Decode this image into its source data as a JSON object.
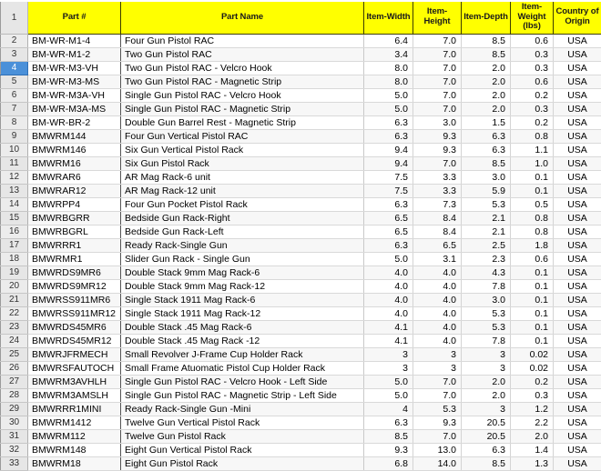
{
  "spreadsheet": {
    "header_row_number": "1",
    "selected_row_number": "4",
    "columns": [
      {
        "key": "rownum",
        "label": ""
      },
      {
        "key": "partnum",
        "label": "Part #"
      },
      {
        "key": "partname",
        "label": "Part Name"
      },
      {
        "key": "width",
        "label": "Item-Width"
      },
      {
        "key": "height",
        "label": "Item-Height"
      },
      {
        "key": "depth",
        "label": "Item-Depth"
      },
      {
        "key": "weight",
        "label": "Item-Weight (lbs)"
      },
      {
        "key": "country",
        "label": "Country of Origin"
      }
    ],
    "colors": {
      "header_background": "#ffff00",
      "header_text": "#1a1a1a",
      "row_header_background": "#ececec",
      "selection": "#4a90d9",
      "grid_line": "#d4d4d4"
    },
    "rows": [
      {
        "n": "2",
        "partnum": "BM-WR-M1-4",
        "partname": "Four Gun Pistol RAC",
        "width": "6.4",
        "height": "7.0",
        "depth": "8.5",
        "weight": "0.6",
        "country": "USA"
      },
      {
        "n": "3",
        "partnum": "BM-WR-M1-2",
        "partname": "Two Gun Pistol RAC",
        "width": "3.4",
        "height": "7.0",
        "depth": "8.5",
        "weight": "0.3",
        "country": "USA"
      },
      {
        "n": "4",
        "partnum": "BM-WR-M3-VH",
        "partname": "Two Gun Pistol RAC - Velcro Hook",
        "width": "8.0",
        "height": "7.0",
        "depth": "2.0",
        "weight": "0.3",
        "country": "USA"
      },
      {
        "n": "5",
        "partnum": "BM-WR-M3-MS",
        "partname": "Two Gun Pistol RAC - Magnetic Strip",
        "width": "8.0",
        "height": "7.0",
        "depth": "2.0",
        "weight": "0.6",
        "country": "USA"
      },
      {
        "n": "6",
        "partnum": "BM-WR-M3A-VH",
        "partname": "Single Gun Pistol RAC - Velcro Hook",
        "width": "5.0",
        "height": "7.0",
        "depth": "2.0",
        "weight": "0.2",
        "country": "USA"
      },
      {
        "n": "7",
        "partnum": "BM-WR-M3A-MS",
        "partname": "Single Gun Pistol RAC - Magnetic Strip",
        "width": "5.0",
        "height": "7.0",
        "depth": "2.0",
        "weight": "0.3",
        "country": "USA"
      },
      {
        "n": "8",
        "partnum": "BM-WR-BR-2",
        "partname": "Double Gun Barrel Rest - Magnetic Strip",
        "width": "6.3",
        "height": "3.0",
        "depth": "1.5",
        "weight": "0.2",
        "country": "USA"
      },
      {
        "n": "9",
        "partnum": "BMWRM144",
        "partname": "Four Gun Vertical  Pistol RAC",
        "width": "6.3",
        "height": "9.3",
        "depth": "6.3",
        "weight": "0.8",
        "country": "USA"
      },
      {
        "n": "10",
        "partnum": "BMWRM146",
        "partname": "Six Gun Vertical Pistol Rack",
        "width": "9.4",
        "height": "9.3",
        "depth": "6.3",
        "weight": "1.1",
        "country": "USA"
      },
      {
        "n": "11",
        "partnum": "BMWRM16",
        "partname": "Six Gun Pistol Rack",
        "width": "9.4",
        "height": "7.0",
        "depth": "8.5",
        "weight": "1.0",
        "country": "USA"
      },
      {
        "n": "12",
        "partnum": "BMWRAR6",
        "partname": "AR Mag Rack-6 unit",
        "width": "7.5",
        "height": "3.3",
        "depth": "3.0",
        "weight": "0.1",
        "country": "USA"
      },
      {
        "n": "13",
        "partnum": "BMWRAR12",
        "partname": "AR Mag Rack-12 unit",
        "width": "7.5",
        "height": "3.3",
        "depth": "5.9",
        "weight": "0.1",
        "country": "USA"
      },
      {
        "n": "14",
        "partnum": "BMWRPP4",
        "partname": "Four Gun Pocket Pistol Rack",
        "width": "6.3",
        "height": "7.3",
        "depth": "5.3",
        "weight": "0.5",
        "country": "USA"
      },
      {
        "n": "15",
        "partnum": "BMWRBGRR",
        "partname": "Bedside Gun Rack-Right",
        "width": "6.5",
        "height": "8.4",
        "depth": "2.1",
        "weight": "0.8",
        "country": "USA"
      },
      {
        "n": "16",
        "partnum": "BMWRBGRL",
        "partname": "Bedside Gun Rack-Left",
        "width": "6.5",
        "height": "8.4",
        "depth": "2.1",
        "weight": "0.8",
        "country": "USA"
      },
      {
        "n": "17",
        "partnum": "BMWRRR1",
        "partname": "Ready Rack-Single Gun",
        "width": "6.3",
        "height": "6.5",
        "depth": "2.5",
        "weight": "1.8",
        "country": "USA"
      },
      {
        "n": "18",
        "partnum": "BMWRMR1",
        "partname": "Slider Gun Rack - Single Gun",
        "width": "5.0",
        "height": "3.1",
        "depth": "2.3",
        "weight": "0.6",
        "country": "USA"
      },
      {
        "n": "19",
        "partnum": "BMWRDS9MR6",
        "partname": "Double Stack 9mm Mag Rack-6",
        "width": "4.0",
        "height": "4.0",
        "depth": "4.3",
        "weight": "0.1",
        "country": "USA"
      },
      {
        "n": "20",
        "partnum": "BMWRDS9MR12",
        "partname": "Double Stack 9mm Mag Rack-12",
        "width": "4.0",
        "height": "4.0",
        "depth": "7.8",
        "weight": "0.1",
        "country": "USA"
      },
      {
        "n": "21",
        "partnum": "BMWRSS911MR6",
        "partname": "Single Stack 1911 Mag Rack-6",
        "width": "4.0",
        "height": "4.0",
        "depth": "3.0",
        "weight": "0.1",
        "country": "USA"
      },
      {
        "n": "22",
        "partnum": "BMWRSS911MR12",
        "partname": "Single Stack 1911 Mag Rack-12",
        "width": "4.0",
        "height": "4.0",
        "depth": "5.3",
        "weight": "0.1",
        "country": "USA"
      },
      {
        "n": "23",
        "partnum": "BMWRDS45MR6",
        "partname": "Double Stack .45 Mag Rack-6",
        "width": "4.1",
        "height": "4.0",
        "depth": "5.3",
        "weight": "0.1",
        "country": "USA"
      },
      {
        "n": "24",
        "partnum": "BMWRDS45MR12",
        "partname": "Double Stack .45 Mag Rack -12",
        "width": "4.1",
        "height": "4.0",
        "depth": "7.8",
        "weight": "0.1",
        "country": "USA"
      },
      {
        "n": "25",
        "partnum": "BMWRJFRMECH",
        "partname": "Small Revolver J-Frame Cup Holder Rack",
        "width": "3",
        "height": "3",
        "depth": "3",
        "weight": "0.02",
        "country": "USA"
      },
      {
        "n": "26",
        "partnum": "BMWRSFAUTOCH",
        "partname": "Small Frame Atuomatic Pistol Cup Holder Rack",
        "width": "3",
        "height": "3",
        "depth": "3",
        "weight": "0.02",
        "country": "USA"
      },
      {
        "n": "27",
        "partnum": "BMWRM3AVHLH",
        "partname": "Single Gun Pistol RAC - Velcro Hook - Left Side",
        "width": "5.0",
        "height": "7.0",
        "depth": "2.0",
        "weight": "0.2",
        "country": "USA"
      },
      {
        "n": "28",
        "partnum": "BMWRM3AMSLH",
        "partname": "Single Gun Pistol RAC - Magnetic Strip - Left Side",
        "width": "5.0",
        "height": "7.0",
        "depth": "2.0",
        "weight": "0.3",
        "country": "USA"
      },
      {
        "n": "29",
        "partnum": "BMWRRR1MINI",
        "partname": "Ready Rack-Single Gun -Mini",
        "width": "4",
        "height": "5.3",
        "depth": "3",
        "weight": "1.2",
        "country": "USA"
      },
      {
        "n": "30",
        "partnum": "BMWRM1412",
        "partname": "Twelve Gun Vertical Pistol Rack",
        "width": "6.3",
        "height": "9.3",
        "depth": "20.5",
        "weight": "2.2",
        "country": "USA"
      },
      {
        "n": "31",
        "partnum": "BMWRM112",
        "partname": "Twelve Gun Pistol Rack",
        "width": "8.5",
        "height": "7.0",
        "depth": "20.5",
        "weight": "2.0",
        "country": "USA"
      },
      {
        "n": "32",
        "partnum": "BMWRM148",
        "partname": "Eight Gun Vertical Pistol Rack",
        "width": "9.3",
        "height": "13.0",
        "depth": "6.3",
        "weight": "1.4",
        "country": "USA"
      },
      {
        "n": "33",
        "partnum": "BMWRM18",
        "partname": "Eight Gun Pistol Rack",
        "width": "6.8",
        "height": "14.0",
        "depth": "8.5",
        "weight": "1.3",
        "country": "USA"
      }
    ]
  }
}
